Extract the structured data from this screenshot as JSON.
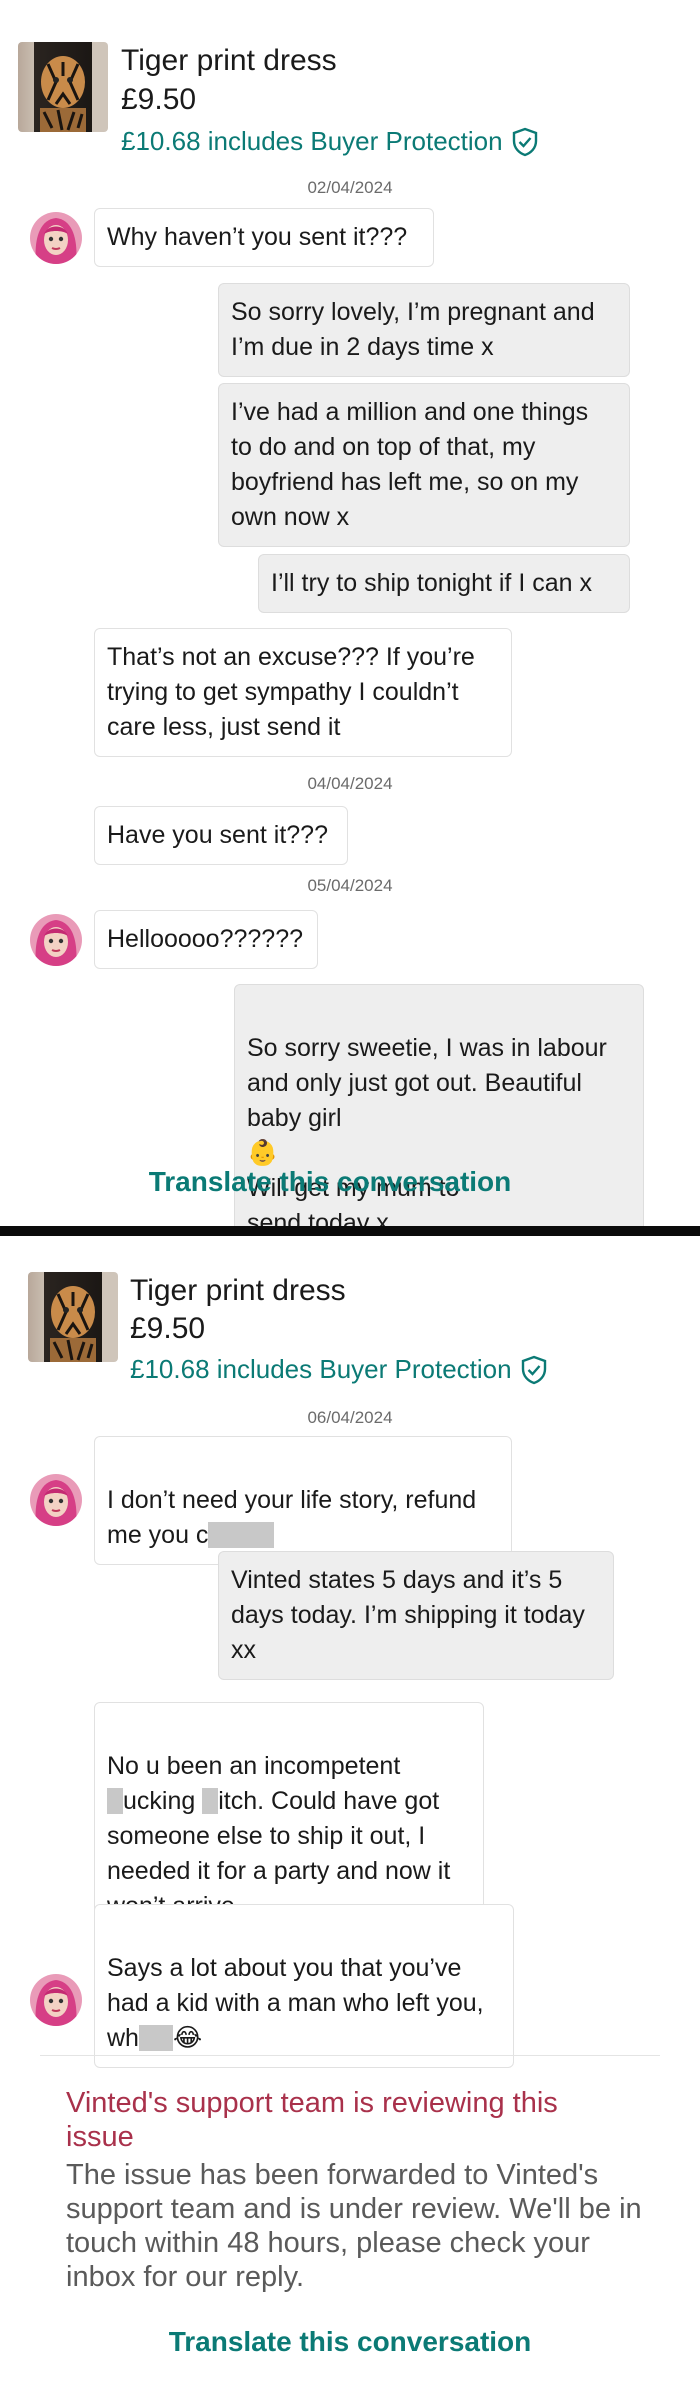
{
  "item": {
    "title": "Tiger print dress",
    "price": "£9.50",
    "protection": "£10.68 includes Buyer Protection",
    "thumbnail_icon": "tiger-print-photo"
  },
  "panel1": {
    "messages": [
      {
        "date": "02/04/2024"
      },
      {
        "side": "incoming",
        "text": "Why haven’t you sent it???"
      },
      {
        "side": "outgoing",
        "text": "So sorry lovely, I’m pregnant and\nI’m due in 2 days time x"
      },
      {
        "side": "outgoing",
        "text": "I’ve had a million and one things\nto do and on top of that, my\nboyfriend has left me, so on my\nown now x"
      },
      {
        "side": "outgoing",
        "text": "I’ll try to ship tonight if I can x"
      },
      {
        "side": "incoming",
        "text": "That’s not an excuse??? If you’re\ntrying to get sympathy I couldn’t\ncare less, just send it"
      },
      {
        "date": "04/04/2024"
      },
      {
        "side": "incoming",
        "text": "Have you sent it???"
      },
      {
        "date": "05/04/2024"
      },
      {
        "side": "incoming",
        "text": "Hellooooo??????"
      },
      {
        "side": "outgoing",
        "text": "So sorry sweetie, I was in labour\nand only just got out. Beautiful\nbaby girl",
        "line4": "Will get my mum to\nsend today x",
        "emoji": "👶"
      }
    ],
    "translate_label": "Translate this conversation"
  },
  "panel2": {
    "date": "06/04/2024",
    "msg1_line1": "I don’t need your life story, refund",
    "msg1_line2": "me you c",
    "msg2": "Vinted states 5 days and it’s 5\ndays today. I’m shipping it today\nxx",
    "msg3_line1": "No u been an incompetent",
    "msg3_line2": "ucking",
    "msg3_line2b": "itch. Could have got",
    "msg3_rest": "someone else to ship it out, I\nneeded it for a party and now it\nwon’t arrive",
    "msg4_lines": "Says a lot about you that you’ve\nhad a kid with a man who left you,",
    "msg4_last": "wh",
    "msg4_emoji": "😂",
    "support_title": "Vinted's support team is reviewing this issue",
    "support_body": "The issue has been forwarded to Vinted's support team and is under review. We'll be in touch within 48 hours, please check your inbox for our reply.",
    "translate_label": "Translate this conversation"
  },
  "colors": {
    "accent_teal": "#0b7a75",
    "support_red": "#a9314b",
    "outgoing_bg": "#eeeeee"
  }
}
